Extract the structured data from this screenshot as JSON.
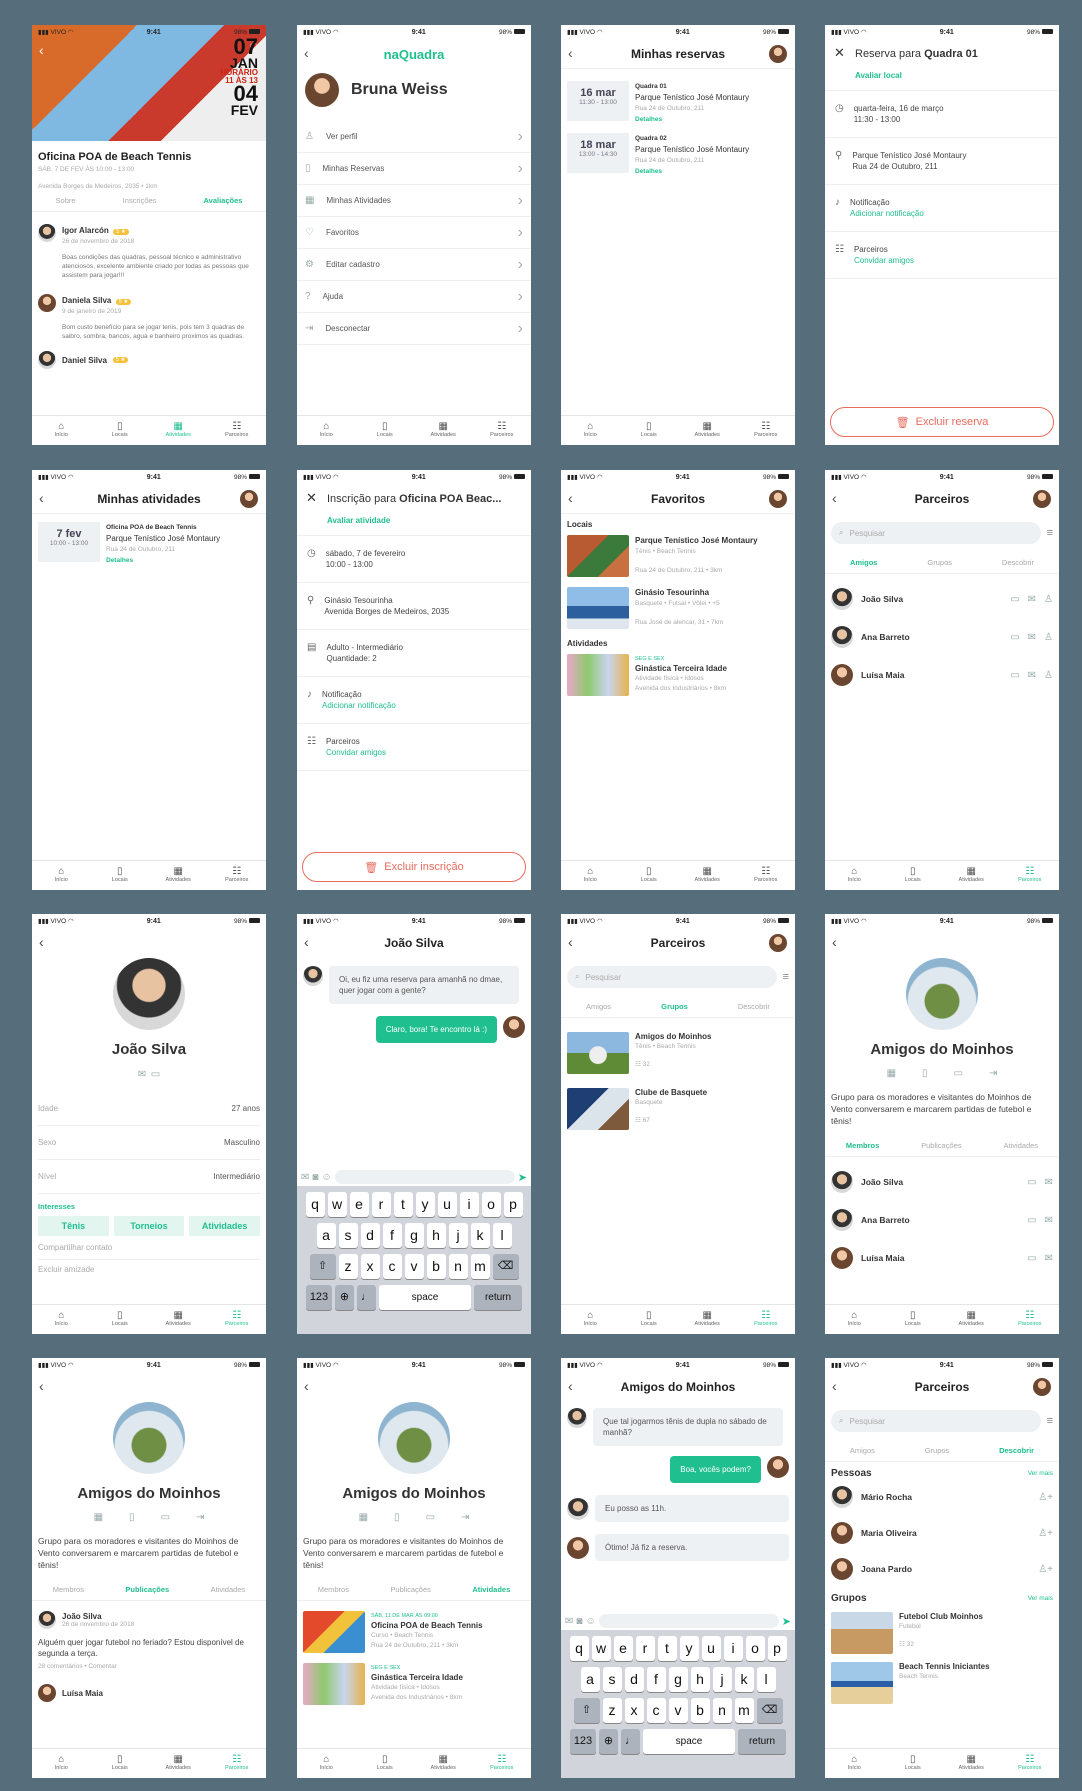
{
  "tabs": [
    "Início",
    "Locais",
    "Atividades",
    "Parceiros"
  ],
  "status": {
    "carrier": "VIVO",
    "time": "9:41",
    "battery": "98%"
  },
  "s1": {
    "poster": {
      "day1": "07",
      "mon1": "JAN",
      "time": "HORÁRIO 11 ÀS 13",
      "day2": "04",
      "mon2": "FEV"
    },
    "title": "Oficina POA de Beach Tennis",
    "date": "SÁB, 7 DE FEV ÀS 10:00 - 13:00",
    "addr": "Avenida Borges de Medeiros, 2035 • 1km",
    "segs": [
      "Sobre",
      "Inscrições",
      "Avaliações"
    ],
    "reviews": [
      {
        "name": "Igor Alarcón",
        "rating": "5 ★",
        "date": "26 de novembro de 2018",
        "text": "Boas condições das quadras, pessoal técnico e administrativo atenciosos, excelente ambiente criado por todas as pessoas que assistem para jogar!!!"
      },
      {
        "name": "Daniela Silva",
        "rating": "5 ★",
        "date": "9 de janeiro de 2019",
        "text": "Bom custo benefício para se jogar tenis, pois tem 3 quadras de saibro, sombra, bancos, agua e banheiro proximos as quadras."
      },
      {
        "name": "Daniel Silva",
        "rating": "5 ★"
      }
    ]
  },
  "s2": {
    "logo": "naQuadra",
    "user": "Bruna Weiss",
    "menu": [
      "Ver perfil",
      "Minhas Reservas",
      "Minhas Atividades",
      "Favoritos",
      "Editar cadastro",
      "Ajuda",
      "Desconectar"
    ]
  },
  "s3": {
    "title": "Minhas reservas",
    "items": [
      {
        "date": "16 mar",
        "time": "11:30 - 13:00",
        "court": "Quadra 01",
        "place": "Parque Tenístico José Montaury",
        "addr": "Rua 24 de Outubro, 211",
        "link": "Detalhes"
      },
      {
        "date": "18 mar",
        "time": "13:00 - 14:30",
        "court": "Quadra 02",
        "place": "Parque Tenístico José Montaury",
        "addr": "Rua 24 de Outubro, 211",
        "link": "Detalhes"
      }
    ]
  },
  "s4": {
    "title_pre": "Reserva para ",
    "title_b": "Quadra 01",
    "rate": "Avaliar local",
    "date": "quarta-feira, 16 de março",
    "time": "11:30 - 13:00",
    "place": "Parque Tenístico José Montaury",
    "addr": "Rua 24 de Outubro, 211",
    "notif": "Notificação",
    "add_notif": "Adicionar notificação",
    "partners": "Parceiros",
    "invite": "Convidar amigos",
    "cancel": "Excluir reserva"
  },
  "s5": {
    "title": "Minhas atividades",
    "item": {
      "date": "7 fev",
      "time": "10:00 - 13:00",
      "name": "Oficina POA de Beach Tennis",
      "place": "Parque Tenístico José Montaury",
      "addr": "Rua 24 de Outubro, 211",
      "link": "Detalhes"
    }
  },
  "s6": {
    "title_pre": "Inscrição para ",
    "title_b": "Oficina POA Beac...",
    "rate": "Avaliar atividade",
    "date": "sábado, 7 de fevereiro",
    "time": "10:00 - 13:00",
    "place": "Ginásio Tesourinha",
    "addr": "Avenida Borges de Medeiros, 2035",
    "level": "Adulto - Intermediário",
    "qty": "Quantidade: 2",
    "notif": "Notificação",
    "add_notif": "Adicionar notificação",
    "partners": "Parceiros",
    "invite": "Convidar amigos",
    "cancel": "Excluir inscrição"
  },
  "s7": {
    "title": "Favoritos",
    "sec1": "Locais",
    "locais": [
      {
        "name": "Parque Tenístico José Montaury",
        "tags": "Tênis • Beach Tennis",
        "addr": "Rua 24 de Outubro, 211 • 3km"
      },
      {
        "name": "Ginásio Tesourinha",
        "tags": "Basquete • Futsal • Vôlei • +5",
        "addr": "Rua José de alencar, 31 • 7km"
      }
    ],
    "sec2": "Atividades",
    "ativ": {
      "when": "SEG E SEX",
      "name": "Ginástica Terceira Idade",
      "tags": "Atividade física • Idosos",
      "addr": "Avenida dos Industriários • 8km"
    }
  },
  "s8": {
    "title": "Parceiros",
    "search": "Pesquisar",
    "segs": [
      "Amigos",
      "Grupos",
      "Descobrir"
    ],
    "friends": [
      "João Silva",
      "Ana Barreto",
      "Luísa Maia"
    ]
  },
  "s9": {
    "name": "João Silva",
    "fields": [
      [
        "Idade",
        "27 anos"
      ],
      [
        "Sexo",
        "Masculino"
      ],
      [
        "Nível",
        "Intermediário"
      ]
    ],
    "interests_label": "Interesses",
    "interests": [
      "Tênis",
      "Torneios",
      "Atividades"
    ],
    "share": "Compartilhar contato",
    "remove": "Excluir amizade"
  },
  "s10": {
    "title": "João Silva",
    "msg_in": "Oi, eu fiz uma reserva para amanhã no dmae, quer jogar com a gente?",
    "msg_out": "Claro, bora! Te encontro lá :)",
    "keys1": [
      "q",
      "w",
      "e",
      "r",
      "t",
      "y",
      "u",
      "i",
      "o",
      "p"
    ],
    "keys2": [
      "a",
      "s",
      "d",
      "f",
      "g",
      "h",
      "j",
      "k",
      "l"
    ],
    "keys3": [
      "z",
      "x",
      "c",
      "v",
      "b",
      "n",
      "m"
    ],
    "k123": "123",
    "space": "space",
    "ret": "return"
  },
  "s11": {
    "title": "Parceiros",
    "search": "Pesquisar",
    "segs": [
      "Amigos",
      "Grupos",
      "Descobrir"
    ],
    "groups": [
      {
        "name": "Amigos do Moinhos",
        "tags": "Tênis • Beach Tennis",
        "count": "32"
      },
      {
        "name": "Clube de Basquete",
        "tags": "Basquete",
        "count": "67"
      }
    ]
  },
  "s12": {
    "name": "Amigos do Moinhos",
    "desc": "Grupo para os moradores e visitantes do Moinhos de Vento conversarem e marcarem partidas de futebol e tênis!",
    "segs": [
      "Membros",
      "Publicações",
      "Atividades"
    ],
    "members": [
      "João Silva",
      "Ana Barreto",
      "Luísa Maia"
    ]
  },
  "s13": {
    "name": "Amigos do Moinhos",
    "desc": "Grupo para os moradores e visitantes do Moinhos de Vento conversarem e marcarem partidas de futebol e tênis!",
    "segs": [
      "Membros",
      "Publicações",
      "Atividades"
    ],
    "post": {
      "name": "João Silva",
      "date": "26 de novembro de 2018",
      "text": "Alguém quer jogar futebol no feriado? Estou disponível de segunda a terça.",
      "meta": "28 comentários • Comentar"
    },
    "post2": "Luísa Maia"
  },
  "s14": {
    "name": "Amigos do Moinhos",
    "desc": "Grupo para os moradores e visitantes do Moinhos de Vento conversarem e marcarem partidas de futebol e tênis!",
    "segs": [
      "Membros",
      "Publicações",
      "Atividades"
    ],
    "acts": [
      {
        "when": "SÁB, 11 DE MAR ÀS 09:00",
        "name": "Oficina POA de Beach Tennis",
        "tags": "Curso • Beach Tennis",
        "addr": "Rua 24 de Outubro, 211 • 3km"
      },
      {
        "when": "SEG E SEX",
        "name": "Ginástica Terceira Idade",
        "tags": "Atividade física • Idosos",
        "addr": "Avenida dos Industriários • 8km"
      }
    ]
  },
  "s15": {
    "title": "Amigos do Moinhos",
    "m1": "Que tal jogarmos tênis de dupla no sábado de manhã?",
    "m2": "Boa, vocês podem?",
    "m3": "Eu posso as 11h.",
    "m4": "Ótimo! Já fiz a reserva."
  },
  "s16": {
    "title": "Parceiros",
    "search": "Pesquisar",
    "segs": [
      "Amigos",
      "Grupos",
      "Descobrir"
    ],
    "sec1": "Pessoas",
    "more": "Ver mais",
    "people": [
      "Mário Rocha",
      "Maria Oliveira",
      "Joana Pardo"
    ],
    "sec2": "Grupos",
    "groups": [
      {
        "name": "Futebol Club Moinhos",
        "tags": "Futebol",
        "count": "32"
      },
      {
        "name": "Beach Tennis Iniciantes",
        "tags": "Beach Tennis"
      }
    ]
  }
}
